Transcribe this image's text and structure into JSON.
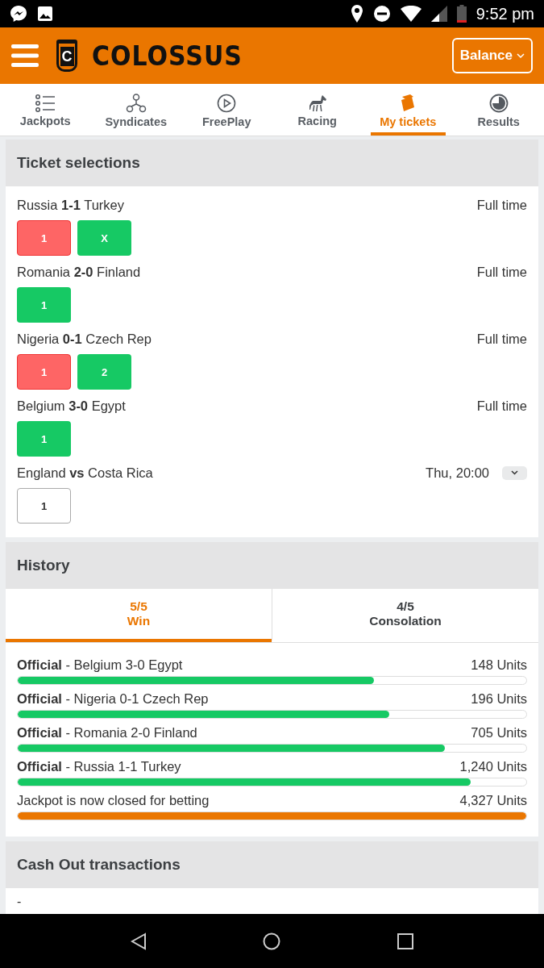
{
  "status_bar": {
    "time": "9:52 pm"
  },
  "header": {
    "brand": "COLOSSUS",
    "logo_letter": "C",
    "balance_button": "Balance"
  },
  "nav_tabs": [
    {
      "label": "Jackpots",
      "selected": false
    },
    {
      "label": "Syndicates",
      "selected": false
    },
    {
      "label": "FreePlay",
      "selected": false
    },
    {
      "label": "Racing",
      "selected": false
    },
    {
      "label": "My tickets",
      "selected": true
    },
    {
      "label": "Results",
      "selected": false
    }
  ],
  "ticket_selections": {
    "title": "Ticket selections",
    "matches": [
      {
        "title": "Russia **1-1** Turkey",
        "status": "Full time",
        "expandable": false,
        "picks": [
          {
            "label": "1",
            "kind": "lost"
          },
          {
            "label": "X",
            "kind": "won"
          }
        ]
      },
      {
        "title": "Romania **2-0** Finland",
        "status": "Full time",
        "expandable": false,
        "picks": [
          {
            "label": "1",
            "kind": "won"
          }
        ]
      },
      {
        "title": "Nigeria **0-1** Czech Rep",
        "status": "Full time",
        "expandable": false,
        "picks": [
          {
            "label": "1",
            "kind": "lost"
          },
          {
            "label": "2",
            "kind": "won"
          }
        ]
      },
      {
        "title": "Belgium **3-0** Egypt",
        "status": "Full time",
        "expandable": false,
        "picks": [
          {
            "label": "1",
            "kind": "won"
          }
        ]
      },
      {
        "title": "England **vs** Costa Rica",
        "status": "Thu, 20:00",
        "expandable": true,
        "picks": [
          {
            "label": "1",
            "kind": "pending"
          }
        ]
      }
    ]
  },
  "history": {
    "title": "History",
    "tabs": [
      {
        "score": "5/5",
        "label": "Win",
        "selected": true
      },
      {
        "score": "4/5",
        "label": "Consolation",
        "selected": false
      }
    ],
    "rows": [
      {
        "text": "**Official** - Belgium 3-0 Egypt",
        "amount": "148 Units",
        "level": 0.7,
        "color": "#16c964"
      },
      {
        "text": "**Official** - Nigeria 0-1 Czech Rep",
        "amount": "196 Units",
        "level": 0.73,
        "color": "#16c964"
      },
      {
        "text": "**Official** - Romania 2-0 Finland",
        "amount": "705 Units",
        "level": 0.84,
        "color": "#16c964"
      },
      {
        "text": "**Official** - Russia 1-1 Turkey",
        "amount": "1,240 Units",
        "level": 0.89,
        "color": "#16c964"
      },
      {
        "text": "Jackpot is now closed for betting",
        "amount": "4,327 Units",
        "level": 1,
        "color": "#ea7600"
      }
    ]
  },
  "cash_out": {
    "title": "Cash Out transactions",
    "value": "-"
  }
}
